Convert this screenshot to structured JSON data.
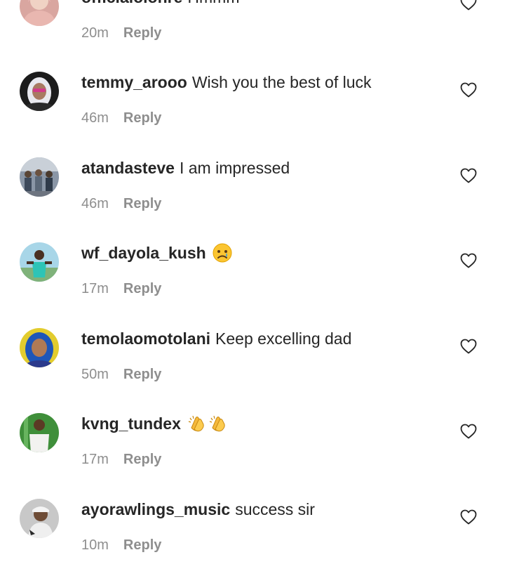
{
  "colors": {
    "text": "#262626",
    "secondary": "#8e8e8e",
    "background": "#ffffff"
  },
  "comments": [
    {
      "username": "officialolohre",
      "text": "Hmmm",
      "time": "20m",
      "reply_label": "Reply",
      "avatar": "avatar-photo-woman-pink"
    },
    {
      "username": "temmy_arooo",
      "text": "Wish you the best of luck",
      "time": "46m",
      "reply_label": "Reply",
      "avatar": "avatar-photo-woman-white-hijab"
    },
    {
      "username": "atandasteve",
      "text": "I am impressed",
      "time": "46m",
      "reply_label": "Reply",
      "avatar": "avatar-photo-group-people"
    },
    {
      "username": "wf_dayola_kush",
      "text": "",
      "emoji": [
        "crying-face-emoji"
      ],
      "time": "17m",
      "reply_label": "Reply",
      "avatar": "avatar-photo-man-outdoor"
    },
    {
      "username": "temolaomotolani",
      "text": "Keep excelling dad",
      "time": "50m",
      "reply_label": "Reply",
      "avatar": "avatar-photo-woman-blue-hair"
    },
    {
      "username": "kvng_tundex",
      "text": "",
      "emoji": [
        "clapping-hands-emoji",
        "clapping-hands-emoji"
      ],
      "time": "17m",
      "reply_label": "Reply",
      "avatar": "avatar-photo-man-green-background"
    },
    {
      "username": "ayorawlings_music",
      "text": "success sir",
      "time": "10m",
      "reply_label": "Reply",
      "avatar": "avatar-photo-man-cap"
    }
  ]
}
